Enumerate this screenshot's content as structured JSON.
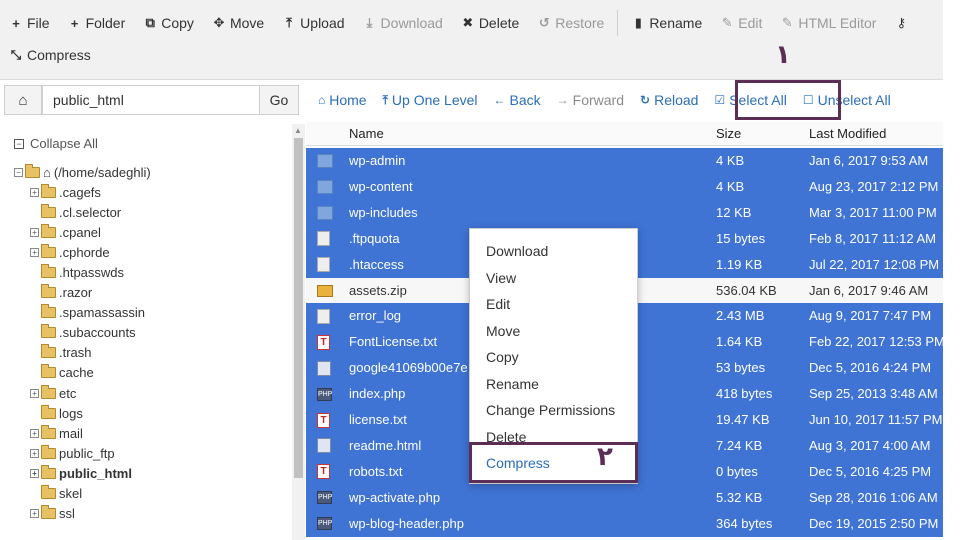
{
  "toolbar": {
    "row1": [
      {
        "icon": "plus-icon",
        "glyph": "+",
        "label": "File",
        "disabled": false
      },
      {
        "icon": "plus-icon",
        "glyph": "+",
        "label": "Folder",
        "disabled": false
      },
      {
        "icon": "copy-icon",
        "glyph": "⧉",
        "label": "Copy",
        "disabled": false
      },
      {
        "icon": "move-icon",
        "glyph": "✥",
        "label": "Move",
        "disabled": false
      },
      {
        "icon": "upload-icon",
        "glyph": "⤒",
        "label": "Upload",
        "disabled": false
      },
      {
        "icon": "download-icon",
        "glyph": "⤓",
        "label": "Download",
        "disabled": true
      },
      {
        "icon": "close-icon",
        "glyph": "✖",
        "label": "Delete",
        "disabled": false
      },
      {
        "icon": "restore-icon",
        "glyph": "↺",
        "label": "Restore",
        "disabled": true
      },
      {
        "icon": "rename-icon",
        "glyph": "▮",
        "label": "Rename",
        "disabled": false
      },
      {
        "icon": "pencil-icon",
        "glyph": "✎",
        "label": "Edit",
        "disabled": true
      },
      {
        "icon": "html-editor-icon",
        "glyph": "✎",
        "label": "HTML Editor",
        "disabled": true
      },
      {
        "icon": "key-icon",
        "glyph": "⚷",
        "label": "",
        "disabled": false
      }
    ],
    "row2": [
      {
        "icon": "compress-icon",
        "glyph": "⤡",
        "label": "Compress",
        "disabled": false
      }
    ]
  },
  "navbar": {
    "home_icon": "home-icon",
    "path_value": "public_html",
    "go_label": "Go",
    "links": [
      {
        "icon": "home-icon",
        "glyph": "⌂",
        "label": "Home",
        "disabled": false
      },
      {
        "icon": "up-arrow-icon",
        "glyph": "⤒",
        "label": "Up One Level",
        "disabled": false
      },
      {
        "icon": "arrow-left-icon",
        "glyph": "←",
        "label": "Back",
        "disabled": false
      },
      {
        "icon": "arrow-right-icon",
        "glyph": "→",
        "label": "Forward",
        "disabled": true
      },
      {
        "icon": "reload-icon",
        "glyph": "↻",
        "label": "Reload",
        "disabled": false
      },
      {
        "icon": "checkbox-checked-icon",
        "glyph": "☑",
        "label": "Select All",
        "disabled": false
      },
      {
        "icon": "checkbox-empty-icon",
        "glyph": "☐",
        "label": "Unselect All",
        "disabled": false
      }
    ]
  },
  "sidebar": {
    "collapse_label": "Collapse All",
    "root_label": "(/home/sadeghli)",
    "items": [
      {
        "label": ".cagefs",
        "expandable": true,
        "bold": false
      },
      {
        "label": ".cl.selector",
        "expandable": false,
        "bold": false
      },
      {
        "label": ".cpanel",
        "expandable": true,
        "bold": false
      },
      {
        "label": ".cphorde",
        "expandable": true,
        "bold": false
      },
      {
        "label": ".htpasswds",
        "expandable": false,
        "bold": false
      },
      {
        "label": ".razor",
        "expandable": false,
        "bold": false
      },
      {
        "label": ".spamassassin",
        "expandable": false,
        "bold": false
      },
      {
        "label": ".subaccounts",
        "expandable": false,
        "bold": false
      },
      {
        "label": ".trash",
        "expandable": false,
        "bold": false
      },
      {
        "label": "cache",
        "expandable": false,
        "bold": false
      },
      {
        "label": "etc",
        "expandable": true,
        "bold": false
      },
      {
        "label": "logs",
        "expandable": false,
        "bold": false
      },
      {
        "label": "mail",
        "expandable": true,
        "bold": false
      },
      {
        "label": "public_ftp",
        "expandable": true,
        "bold": false
      },
      {
        "label": "public_html",
        "expandable": true,
        "bold": true
      },
      {
        "label": "skel",
        "expandable": false,
        "bold": false
      },
      {
        "label": "ssl",
        "expandable": true,
        "bold": false
      }
    ]
  },
  "table": {
    "headers": {
      "name": "Name",
      "size": "Size",
      "modified": "Last Modified"
    },
    "rows": [
      {
        "icon": "folder",
        "name": "wp-admin",
        "size": "4 KB",
        "modified": "Jan 6, 2017 9:53 AM",
        "selected": true
      },
      {
        "icon": "folder",
        "name": "wp-content",
        "size": "4 KB",
        "modified": "Aug 23, 2017 2:12 PM",
        "selected": true
      },
      {
        "icon": "folder",
        "name": "wp-includes",
        "size": "12 KB",
        "modified": "Mar 3, 2017 11:00 PM",
        "selected": true
      },
      {
        "icon": "doc",
        "name": ".ftpquota",
        "size": "15 bytes",
        "modified": "Feb 8, 2017 11:12 AM",
        "selected": true
      },
      {
        "icon": "doc",
        "name": ".htaccess",
        "size": "1.19 KB",
        "modified": "Jul 22, 2017 12:08 PM",
        "selected": true
      },
      {
        "icon": "zip",
        "name": "assets.zip",
        "size": "536.04 KB",
        "modified": "Jan 6, 2017 9:46 AM",
        "selected": false
      },
      {
        "icon": "doc",
        "name": "error_log",
        "size": "2.43 MB",
        "modified": "Aug 9, 2017 7:47 PM",
        "selected": true
      },
      {
        "icon": "pdf",
        "name": "FontLicense.txt",
        "size": "1.64 KB",
        "modified": "Feb 22, 2017 12:53 PM",
        "selected": true
      },
      {
        "icon": "web",
        "name": "google41069b00e7e",
        "size": "53 bytes",
        "modified": "Dec 5, 2016 4:24 PM",
        "selected": true
      },
      {
        "icon": "php",
        "name": "index.php",
        "size": "418 bytes",
        "modified": "Sep 25, 2013 3:48 AM",
        "selected": true
      },
      {
        "icon": "pdf",
        "name": "license.txt",
        "size": "19.47 KB",
        "modified": "Jun 10, 2017 11:57 PM",
        "selected": true
      },
      {
        "icon": "web",
        "name": "readme.html",
        "size": "7.24 KB",
        "modified": "Aug 3, 2017 4:00 AM",
        "selected": true
      },
      {
        "icon": "pdf",
        "name": "robots.txt",
        "size": "0 bytes",
        "modified": "Dec 5, 2016 4:25 PM",
        "selected": true
      },
      {
        "icon": "php",
        "name": "wp-activate.php",
        "size": "5.32 KB",
        "modified": "Sep 28, 2016 1:06 AM",
        "selected": true
      },
      {
        "icon": "php",
        "name": "wp-blog-header.php",
        "size": "364 bytes",
        "modified": "Dec 19, 2015 2:50 PM",
        "selected": true
      }
    ]
  },
  "context_menu": {
    "items": [
      "Download",
      "View",
      "Edit",
      "Move",
      "Copy",
      "Rename",
      "Change Permissions",
      "Delete",
      "Compress"
    ]
  },
  "annotations": {
    "step1": "۱",
    "step2": "۲"
  },
  "colors": {
    "selection": "#3f73d4",
    "link": "#2a6ebb",
    "annotation": "#5c2d55"
  }
}
